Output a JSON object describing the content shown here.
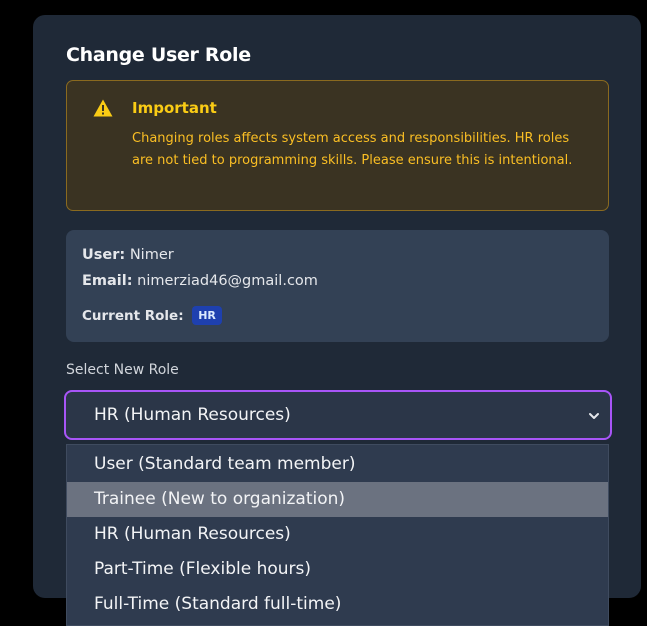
{
  "dialog": {
    "title": "Change User Role"
  },
  "warning": {
    "icon": "warning-triangle-icon",
    "title": "Important",
    "text": "Changing roles affects system access and responsibilities. HR roles are not tied to programming skills. Please ensure this is intentional."
  },
  "user_info": {
    "user_label": "User:",
    "user_value": "Nimer",
    "email_label": "Email:",
    "email_value": "nimerziad46@gmail.com",
    "role_label": "Current Role:",
    "role_value": "HR"
  },
  "role_select": {
    "label": "Select New Role",
    "selected": "HR (Human Resources)",
    "chevron_icon": "chevron-down-icon",
    "options": [
      "User (Standard team member)",
      "Trainee (New to organization)",
      "HR (Human Resources)",
      "Part-Time (Flexible hours)",
      "Full-Time (Standard full-time)"
    ],
    "highlighted_option": "Trainee (New to organization)"
  },
  "colors": {
    "dialog_bg": "#1f2937",
    "warning_text": "#fbbf24",
    "focus_border": "#a855f7",
    "badge_bg": "#1e40af"
  }
}
